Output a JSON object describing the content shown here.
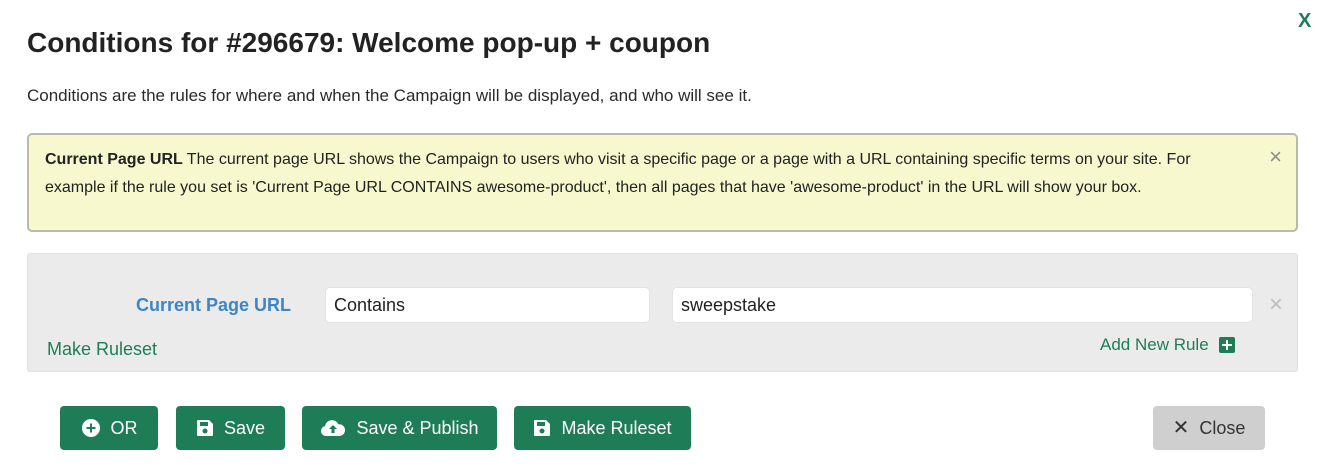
{
  "modal": {
    "close_glyph": "X",
    "title": "Conditions for #296679: Welcome pop-up + coupon",
    "description": "Conditions are the rules for where and when the Campaign will be displayed, and who will see it."
  },
  "info_box": {
    "title": "Current Page URL",
    "text": "The current page URL shows the Campaign to users who visit a specific page or a page with a URL containing specific terms on your site. For example if the rule you set is 'Current Page URL CONTAINS awesome-product', then all pages that have 'awesome-product' in the URL will show your box.",
    "close_glyph": "×",
    "background": "#f7f8cd"
  },
  "rule": {
    "label": "Current Page URL",
    "operator": "Contains",
    "value": "sweepstake",
    "remove_glyph": "×"
  },
  "ruleset": {
    "make_ruleset_link": "Make Ruleset",
    "add_new_rule": "Add New Rule"
  },
  "buttons": {
    "or": "OR",
    "save": "Save",
    "save_publish": "Save & Publish",
    "make_ruleset": "Make Ruleset",
    "close": "Close",
    "close_glyph": "✕"
  },
  "icons": {
    "or": "plus-circle-icon",
    "save": "floppy-disk-icon",
    "save_publish": "cloud-upload-icon",
    "make_ruleset": "floppy-disk-icon",
    "add_rule": "plus-square-icon",
    "close": "close-icon"
  },
  "colors": {
    "accent_green": "#1e7d57",
    "rule_label_blue": "#3c86c6",
    "close_button_gray": "#cfcfcf"
  }
}
